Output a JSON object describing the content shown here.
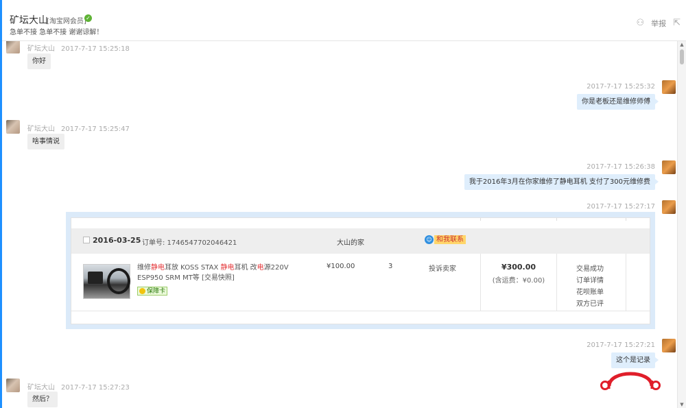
{
  "header": {
    "name": "矿坛大山",
    "tag": "[淘宝网会员]",
    "subtitle": "急单不接 急单不接 谢谢谅解！",
    "report_label": "举报",
    "icons": {
      "verified": "check-circle-icon",
      "user": "user-add-icon",
      "exit": "share-exit-icon"
    }
  },
  "messages": [
    {
      "side": "left",
      "sender": "矿坛大山",
      "time": "2017-7-17 15:25:18",
      "text": "你好"
    },
    {
      "side": "right",
      "time": "2017-7-17 15:25:32",
      "text": "你是老板还是维修师傅"
    },
    {
      "side": "left",
      "sender": "矿坛大山",
      "time": "2017-7-17 15:25:47",
      "text": "啥事情说"
    },
    {
      "side": "right",
      "time": "2017-7-17 15:26:38",
      "text": "我于2016年3月在你家维修了静电耳机 支付了300元维修费"
    },
    {
      "side": "right",
      "time": "2017-7-17 15:27:17",
      "text": ""
    },
    {
      "side": "right",
      "time": "2017-7-17 15:27:21",
      "text": "这个是记录"
    },
    {
      "side": "left",
      "sender": "矿坛大山",
      "time": "2017-7-17 15:27:23",
      "text": "然后？"
    }
  ],
  "order": {
    "date": "2016-03-25",
    "order_number": "订单号: 1746547702046421",
    "shop": "大山的家",
    "contact_label": "和我联系",
    "product_title": {
      "part1": "维修",
      "part2": "静电",
      "part3": "耳放 KOSS STAX ",
      "part4": "静电",
      "part5": "耳机 改",
      "part6": "电",
      "part7": "源220V ESP950 SRM MT等 [交易快照]"
    },
    "badge": "保障卡",
    "price": "¥100.00",
    "quantity": "3",
    "complain": "投诉卖家",
    "total": "¥300.00",
    "shipping": "(含运费：¥0.00)",
    "status_links": [
      "交易成功",
      "订单详情",
      "花呗账单",
      "双方已评"
    ]
  },
  "colors": {
    "accent": "#1e90ff",
    "bubble_right": "#dfeefc",
    "bubble_left": "#eeeeee",
    "highlight_red": "#e4393c",
    "logo_red": "#e01e2a"
  }
}
